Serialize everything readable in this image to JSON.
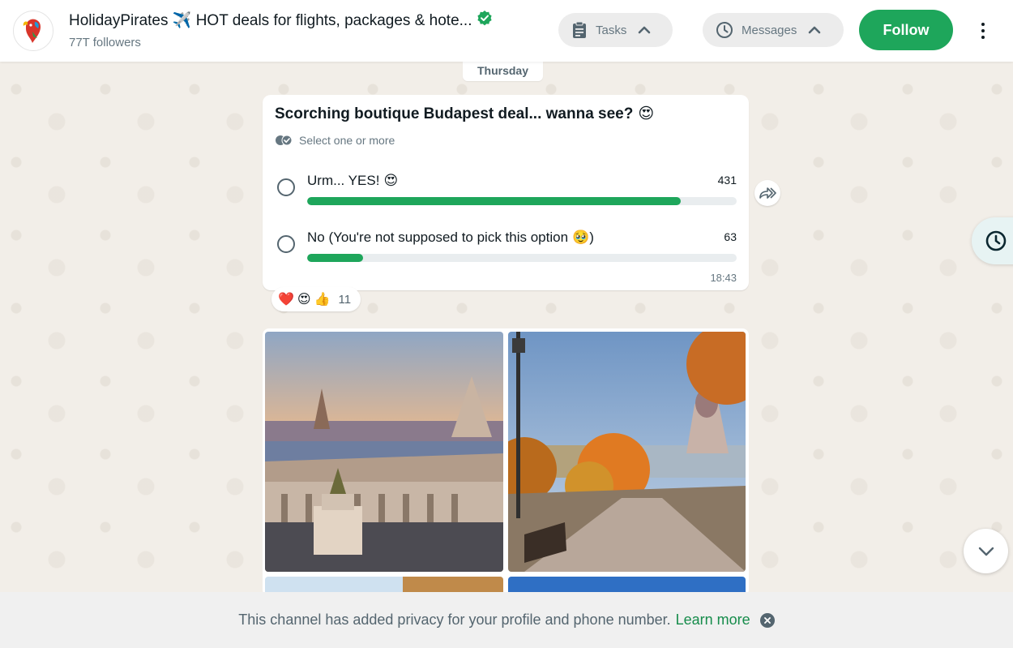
{
  "colors": {
    "accent": "#1ea65b",
    "link": "#168c4b",
    "header_bg": "#ffffff",
    "chat_bg": "#f2eee8",
    "muted_text": "#667781"
  },
  "header": {
    "channel_name": "HolidayPirates ✈️ HOT deals for flights, packages & hote...",
    "followers": "77T followers",
    "avatar_icon": "parrot-logo-icon",
    "verified_icon": "verified-badge-icon",
    "tasks_label": "Tasks",
    "messages_label": "Messages",
    "follow_label": "Follow",
    "menu_icon": "kebab-menu-icon"
  },
  "date_chip": "Thursday",
  "poll": {
    "question": "Scorching boutique Budapest deal... wanna see?",
    "question_emoji": "😍",
    "subtitle": "Select one or more",
    "options": [
      {
        "label": "Urm... YES!",
        "emoji": "😍",
        "count": "431",
        "fraction": 0.87
      },
      {
        "label": "No (You're not supposed to pick this option",
        "emoji": "🥹",
        "suffix": ")",
        "count": "63",
        "fraction": 0.13
      }
    ],
    "time": "18:43"
  },
  "reactions": {
    "emojis": [
      "❤️",
      "😍",
      "👍"
    ],
    "count": "11"
  },
  "footer": {
    "text": "This channel has added privacy for your profile and phone number.",
    "link": "Learn more"
  }
}
